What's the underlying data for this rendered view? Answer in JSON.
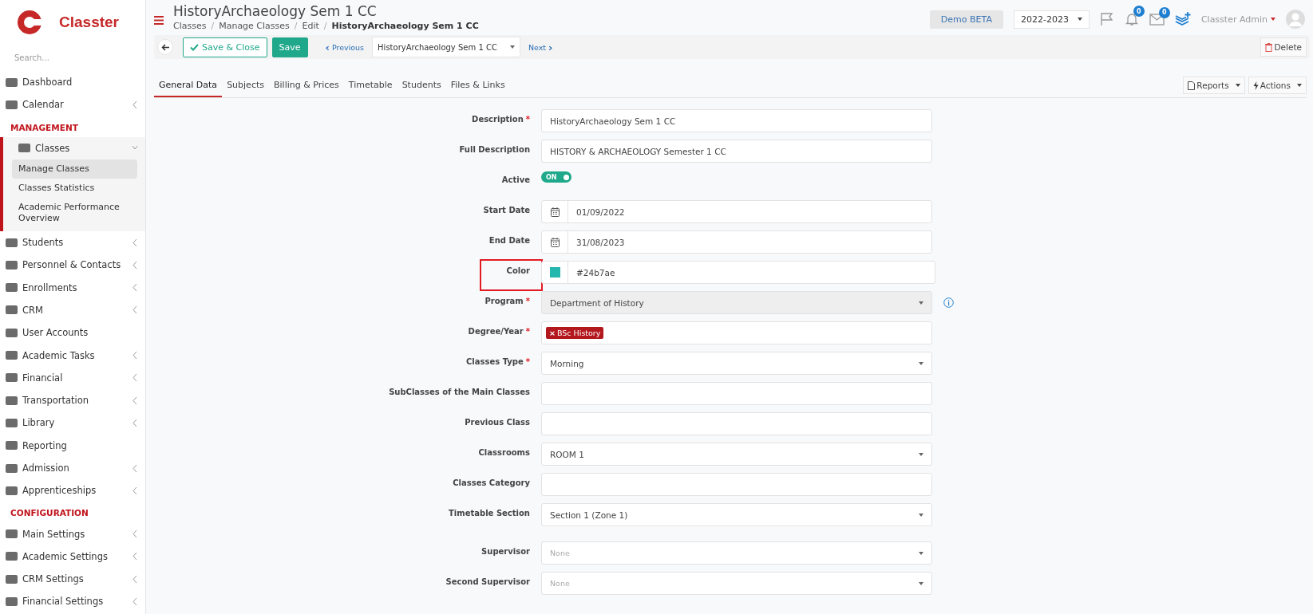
{
  "brand": {
    "name": "Classter"
  },
  "sidebar": {
    "search_placeholder": "Search...",
    "items": [
      {
        "kind": "item",
        "label": "Dashboard",
        "has_submenu": false,
        "expanded": false
      },
      {
        "kind": "item",
        "label": "Calendar",
        "has_submenu": true,
        "expanded": false
      },
      {
        "kind": "section",
        "label": "MANAGEMENT"
      },
      {
        "kind": "item",
        "label": "Classes",
        "has_submenu": true,
        "expanded": true,
        "children": [
          {
            "label": "Manage Classes",
            "selected": true
          },
          {
            "label": "Classes Statistics",
            "selected": false
          },
          {
            "label": "Academic Performance Overview",
            "selected": false
          }
        ]
      },
      {
        "kind": "item",
        "label": "Students",
        "has_submenu": true,
        "expanded": false
      },
      {
        "kind": "item",
        "label": "Personnel & Contacts",
        "has_submenu": true,
        "expanded": false
      },
      {
        "kind": "item",
        "label": "Enrollments",
        "has_submenu": true,
        "expanded": false
      },
      {
        "kind": "item",
        "label": "CRM",
        "has_submenu": true,
        "expanded": false
      },
      {
        "kind": "item",
        "label": "User Accounts",
        "has_submenu": false,
        "expanded": false
      },
      {
        "kind": "item",
        "label": "Academic Tasks",
        "has_submenu": true,
        "expanded": false
      },
      {
        "kind": "item",
        "label": "Financial",
        "has_submenu": true,
        "expanded": false
      },
      {
        "kind": "item",
        "label": "Transportation",
        "has_submenu": true,
        "expanded": false
      },
      {
        "kind": "item",
        "label": "Library",
        "has_submenu": true,
        "expanded": false
      },
      {
        "kind": "item",
        "label": "Reporting",
        "has_submenu": false,
        "expanded": false
      },
      {
        "kind": "item",
        "label": "Admission",
        "has_submenu": true,
        "expanded": false
      },
      {
        "kind": "item",
        "label": "Apprenticeships",
        "has_submenu": true,
        "expanded": false
      },
      {
        "kind": "section",
        "label": "CONFIGURATION"
      },
      {
        "kind": "item",
        "label": "Main Settings",
        "has_submenu": true,
        "expanded": false
      },
      {
        "kind": "item",
        "label": "Academic Settings",
        "has_submenu": true,
        "expanded": false
      },
      {
        "kind": "item",
        "label": "CRM Settings",
        "has_submenu": true,
        "expanded": false
      },
      {
        "kind": "item",
        "label": "Financial Settings",
        "has_submenu": true,
        "expanded": false
      }
    ]
  },
  "header": {
    "title": "HistoryArchaeology Sem 1 CC",
    "breadcrumb": [
      {
        "label": "Classes",
        "current": false,
        "separator": "/"
      },
      {
        "label": "Manage Classes",
        "current": false,
        "separator": "/"
      },
      {
        "label": "Edit",
        "current": false,
        "separator": "/"
      },
      {
        "label": "HistoryArchaeology Sem 1 CC",
        "current": true
      }
    ],
    "demo_badge": "Demo BETA",
    "year": "2022-2023",
    "notifications": "0",
    "messages": "0",
    "user": "Classter Admin"
  },
  "toolbar": {
    "save_close": "Save & Close",
    "save": "Save",
    "previous_icon": "‹",
    "previous": "Previous",
    "next_icon": "›",
    "record": "HistoryArchaeology Sem 1 CC",
    "next": "Next",
    "delete": "Delete"
  },
  "tabs": [
    {
      "label": "General Data",
      "selected": true
    },
    {
      "label": "Subjects",
      "selected": false
    },
    {
      "label": "Billing & Prices",
      "selected": false
    },
    {
      "label": "Timetable",
      "selected": false
    },
    {
      "label": "Students",
      "selected": false
    },
    {
      "label": "Files & Links",
      "selected": false
    }
  ],
  "tab_actions": {
    "reports": "Reports",
    "actions": "Actions"
  },
  "form": [
    {
      "kind": "text",
      "label": "Description",
      "required_mark": "*",
      "value": "HistoryArchaeology Sem 1 CC"
    },
    {
      "kind": "text",
      "label": "Full Description",
      "value": "HISTORY & ARCHAEOLOGY Semester 1 CC"
    },
    {
      "kind": "toggle",
      "label": "Active",
      "on": true,
      "value": "ON"
    },
    {
      "kind": "date",
      "label": "Start Date",
      "value": "01/09/2022"
    },
    {
      "kind": "date",
      "label": "End Date",
      "value": "31/08/2023"
    },
    {
      "kind": "color",
      "label": "Color",
      "value": "#24b7ae",
      "color": "#24b7ae",
      "highlighted": true
    },
    {
      "kind": "select",
      "label": "Program",
      "required_mark": "*",
      "value": "Department of History",
      "disabled": true,
      "info": true
    },
    {
      "kind": "tags",
      "label": "Degree/Year",
      "required_mark": "*",
      "tags": [
        {
          "label": "BSc History",
          "remove": "×"
        }
      ]
    },
    {
      "kind": "select",
      "label": "Classes Type",
      "required_mark": "*",
      "value": "Morning"
    },
    {
      "kind": "text",
      "label": "SubClasses of the Main Classes"
    },
    {
      "kind": "text",
      "label": "Previous Class"
    },
    {
      "kind": "select",
      "label": "Classrooms",
      "value": "ROOM 1"
    },
    {
      "kind": "text",
      "label": "Classes Category"
    },
    {
      "kind": "select",
      "label": "Timetable Section",
      "value": "Section 1 (Zone 1)"
    },
    {
      "kind": "select",
      "label": "Supervisor",
      "placeholder": "None"
    },
    {
      "kind": "select",
      "label": "Second Supervisor",
      "placeholder": "None"
    }
  ]
}
